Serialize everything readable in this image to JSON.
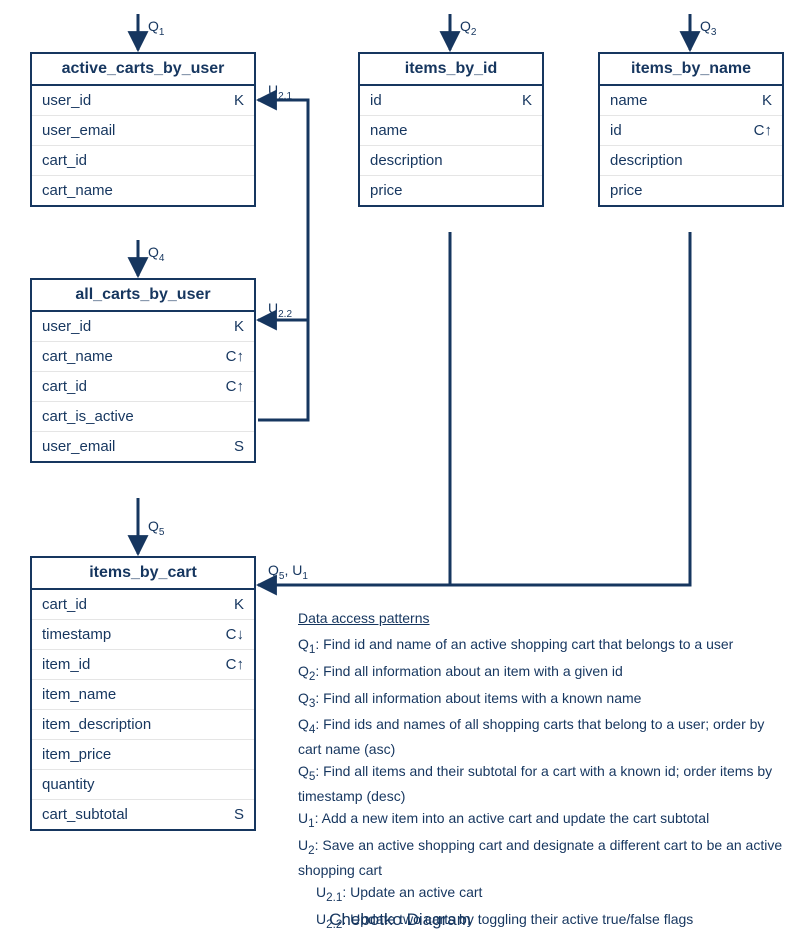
{
  "caption": "Chebotko Diagram",
  "labels": {
    "q1": "Q",
    "q1_sub": "1",
    "q2": "Q",
    "q2_sub": "2",
    "q3": "Q",
    "q3_sub": "3",
    "q4": "Q",
    "q4_sub": "4",
    "q5": "Q",
    "q5_sub": "5",
    "q5u1": "Q",
    "q5u1_sub": "5",
    "q5u1_b": ", U",
    "q5u1_bsub": "1",
    "u21": "U",
    "u21_sub": "2.1",
    "u22": "U",
    "u22_sub": "2.2"
  },
  "tables": {
    "active_carts_by_user": {
      "title": "active_carts_by_user",
      "rows": [
        {
          "name": "user_id",
          "key": "K"
        },
        {
          "name": "user_email",
          "key": ""
        },
        {
          "name": "cart_id",
          "key": ""
        },
        {
          "name": "cart_name",
          "key": ""
        }
      ]
    },
    "items_by_id": {
      "title": "items_by_id",
      "rows": [
        {
          "name": "id",
          "key": "K"
        },
        {
          "name": "name",
          "key": ""
        },
        {
          "name": "description",
          "key": ""
        },
        {
          "name": "price",
          "key": ""
        }
      ]
    },
    "items_by_name": {
      "title": "items_by_name",
      "rows": [
        {
          "name": "name",
          "key": "K"
        },
        {
          "name": "id",
          "key": "C↑"
        },
        {
          "name": "description",
          "key": ""
        },
        {
          "name": "price",
          "key": ""
        }
      ]
    },
    "all_carts_by_user": {
      "title": "all_carts_by_user",
      "rows": [
        {
          "name": "user_id",
          "key": "K"
        },
        {
          "name": "cart_name",
          "key": "C↑"
        },
        {
          "name": "cart_id",
          "key": "C↑"
        },
        {
          "name": "cart_is_active",
          "key": ""
        },
        {
          "name": "user_email",
          "key": "S"
        }
      ]
    },
    "items_by_cart": {
      "title": "items_by_cart",
      "rows": [
        {
          "name": "cart_id",
          "key": "K"
        },
        {
          "name": "timestamp",
          "key": "C↓"
        },
        {
          "name": "item_id",
          "key": "C↑"
        },
        {
          "name": "item_name",
          "key": ""
        },
        {
          "name": "item_description",
          "key": ""
        },
        {
          "name": "item_price",
          "key": ""
        },
        {
          "name": "quantity",
          "key": ""
        },
        {
          "name": "cart_subtotal",
          "key": "S"
        }
      ]
    }
  },
  "patterns": {
    "title": "Data access patterns",
    "items": [
      {
        "label": "Q",
        "sub": "1",
        "text": ": Find id and name of an active shopping cart that belongs to a user"
      },
      {
        "label": "Q",
        "sub": "2",
        "text": ": Find all information about an item with a given id"
      },
      {
        "label": "Q",
        "sub": "3",
        "text": ": Find all information about items with a known name"
      },
      {
        "label": "Q",
        "sub": "4",
        "text": ": Find ids and names of all shopping carts that belong to a user; order by cart name (asc)"
      },
      {
        "label": "Q",
        "sub": "5",
        "text": ": Find all items and their subtotal for a cart with a known id; order items by timestamp (desc)"
      },
      {
        "label": "U",
        "sub": "1",
        "text": ": Add a new item into an active cart and update the cart subtotal"
      },
      {
        "label": "U",
        "sub": "2",
        "text": ": Save an active shopping cart and designate a different cart to be an active shopping cart"
      },
      {
        "label": "U",
        "sub": "2.1",
        "text": ": Update an active cart",
        "indent": true
      },
      {
        "label": "U",
        "sub": "2.2",
        "text": ": Update two carts by toggling their active true/false flags",
        "indent": true
      }
    ]
  }
}
